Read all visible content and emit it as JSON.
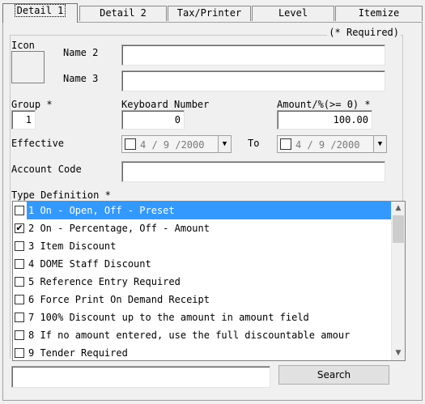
{
  "tabs": [
    {
      "label": "Detail 1",
      "active": true
    },
    {
      "label": "Detail 2"
    },
    {
      "label": "Tax/Printer"
    },
    {
      "label": "Level"
    },
    {
      "label": "Itemize"
    }
  ],
  "required_note": "(* Required)",
  "labels": {
    "icon": "Icon",
    "name2": "Name 2",
    "name3": "Name 3",
    "group": "Group *",
    "keyboard_number": "Keyboard Number",
    "amount": "Amount/%(>= 0) *",
    "effective": "Effective",
    "to": "To",
    "account_code": "Account Code",
    "type_definition": "Type Definition *"
  },
  "fields": {
    "name2": "",
    "name3": "",
    "group": "1",
    "keyboard_number": "0",
    "amount": "100.00",
    "account_code": "",
    "effective_date": "4 / 9 /2000",
    "to_date": "4 / 9 /2000",
    "search": ""
  },
  "type_definitions": [
    {
      "text": "1 On - Open, Off - Preset",
      "checked": false,
      "selected": true
    },
    {
      "text": "2 On - Percentage, Off - Amount",
      "checked": true,
      "selected": false
    },
    {
      "text": "3 Item Discount",
      "checked": false,
      "selected": false
    },
    {
      "text": "4 DOME Staff Discount",
      "checked": false,
      "selected": false
    },
    {
      "text": "5 Reference Entry Required",
      "checked": false,
      "selected": false
    },
    {
      "text": "6 Force Print On Demand Receipt",
      "checked": false,
      "selected": false
    },
    {
      "text": "7 100% Discount up to the amount in amount field",
      "checked": false,
      "selected": false
    },
    {
      "text": "8 If no amount entered, use the full discountable amour",
      "checked": false,
      "selected": false
    },
    {
      "text": "9 Tender Required",
      "checked": false,
      "selected": false
    }
  ],
  "buttons": {
    "search": "Search"
  },
  "colors": {
    "selection": "#3399ff",
    "background": "#f0f0f0"
  }
}
